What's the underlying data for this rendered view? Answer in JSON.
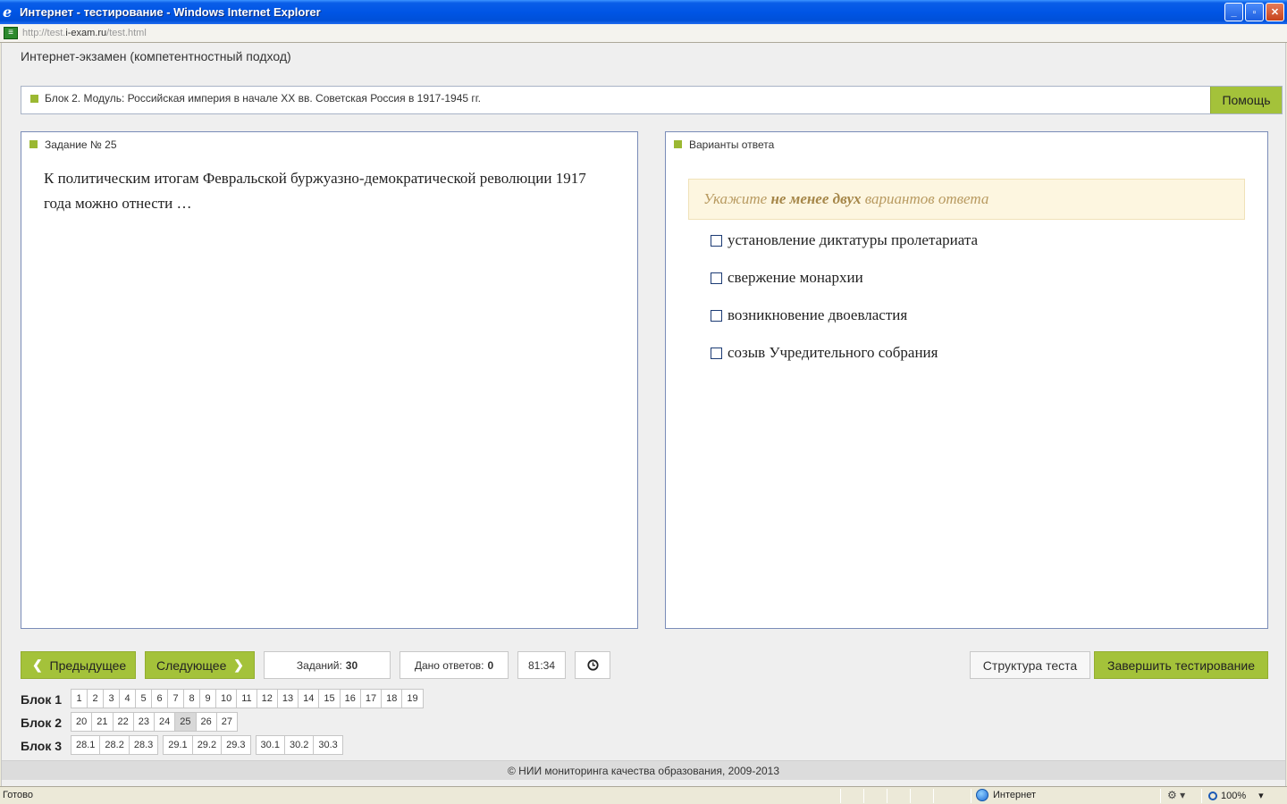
{
  "window": {
    "title": "Интернет - тестирование - Windows Internet Explorer",
    "minimize": "_",
    "maximize": "▫",
    "close": "✕"
  },
  "address": {
    "prefix": "http://test.",
    "domain": "i-exam.ru",
    "suffix": "/test.html"
  },
  "page": {
    "header": "Интернет-экзамен (компетентностный подход)",
    "block_title": "Блок 2. Модуль: Российская империя в начале XX вв. Советская Россия в 1917-1945 гг.",
    "help_label": "Помощь"
  },
  "task": {
    "title": "Задание № 25",
    "text": "К политическим итогам Февральской буржуазно-демократической революции 1917 года можно отнести …"
  },
  "answers": {
    "title": "Варианты ответа",
    "hint_pre": "Укажите",
    "hint_bold": "не менее двух",
    "hint_post": "вариантов ответа",
    "options": [
      "установление диктатуры пролетариата",
      "свержение монархии",
      "возникновение двоевластия",
      "созыв Учредительного собрания"
    ]
  },
  "controls": {
    "prev_label": "Предыдущее",
    "next_label": "Следующее",
    "tasks_label": "Заданий:",
    "tasks_count": "30",
    "answered_label": "Дано ответов:",
    "answered_count": "0",
    "timer": "81:34",
    "structure_label": "Структура теста",
    "finish_label": "Завершить тестирование"
  },
  "navigation": {
    "current": "25",
    "blocks": [
      {
        "label": "Блок 1",
        "groups": [
          [
            "1",
            "2",
            "3",
            "4",
            "5",
            "6",
            "7",
            "8",
            "9",
            "10",
            "11",
            "12",
            "13",
            "14",
            "15",
            "16",
            "17",
            "18",
            "19"
          ]
        ]
      },
      {
        "label": "Блок 2",
        "groups": [
          [
            "20",
            "21",
            "22",
            "23",
            "24",
            "25",
            "26",
            "27"
          ]
        ]
      },
      {
        "label": "Блок 3",
        "groups": [
          [
            "28.1",
            "28.2",
            "28.3"
          ],
          [
            "29.1",
            "29.2",
            "29.3"
          ],
          [
            "30.1",
            "30.2",
            "30.3"
          ]
        ]
      }
    ]
  },
  "footer": "© НИИ мониторинга качества образования, 2009-2013",
  "status": {
    "ready": "Готово",
    "zone": "Интернет",
    "zoom": "100%"
  }
}
